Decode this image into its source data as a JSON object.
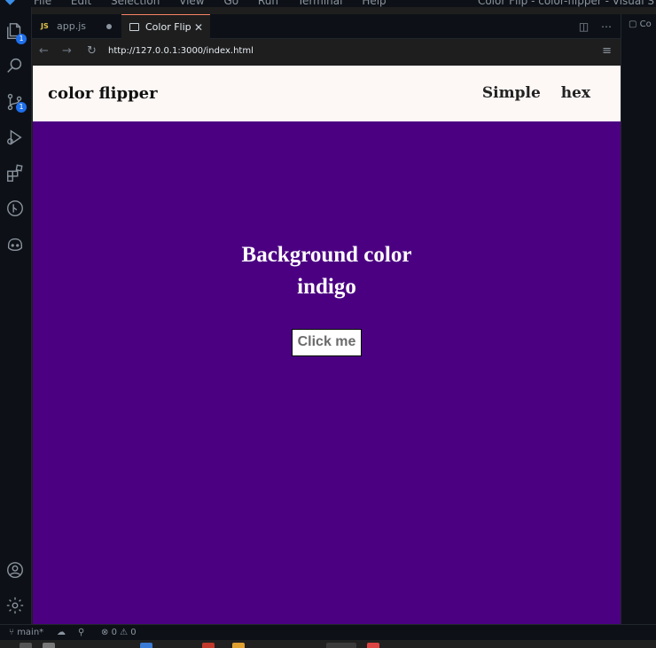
{
  "window": {
    "menu": [
      "File",
      "Edit",
      "Selection",
      "View",
      "Go",
      "Run",
      "Terminal",
      "Help"
    ],
    "title": "Color Flip - color-flipper - Visual S"
  },
  "activity_bar": {
    "explorer_badge": "1",
    "scm_badge": "1"
  },
  "tabs": [
    {
      "label": "app.js",
      "icon": "JS"
    },
    {
      "label": "Color Flip",
      "active": true
    }
  ],
  "right_panel": {
    "tab_label": "Co"
  },
  "browser": {
    "url": "http://127.0.0.1:3000/index.html"
  },
  "page": {
    "brand": "color flipper",
    "nav_links": [
      "Simple",
      "hex"
    ],
    "heading_line1": "Background color",
    "color_name": "indigo",
    "button_label": "Click me",
    "background_color": "#4b0082"
  },
  "status_bar": {
    "branch": "main*",
    "errors": "0",
    "warnings": "0"
  },
  "colors": {
    "accent_badge": "#1f6feb",
    "tab_active_border": "#f78166",
    "nav_bg": "#fdf8f6"
  }
}
